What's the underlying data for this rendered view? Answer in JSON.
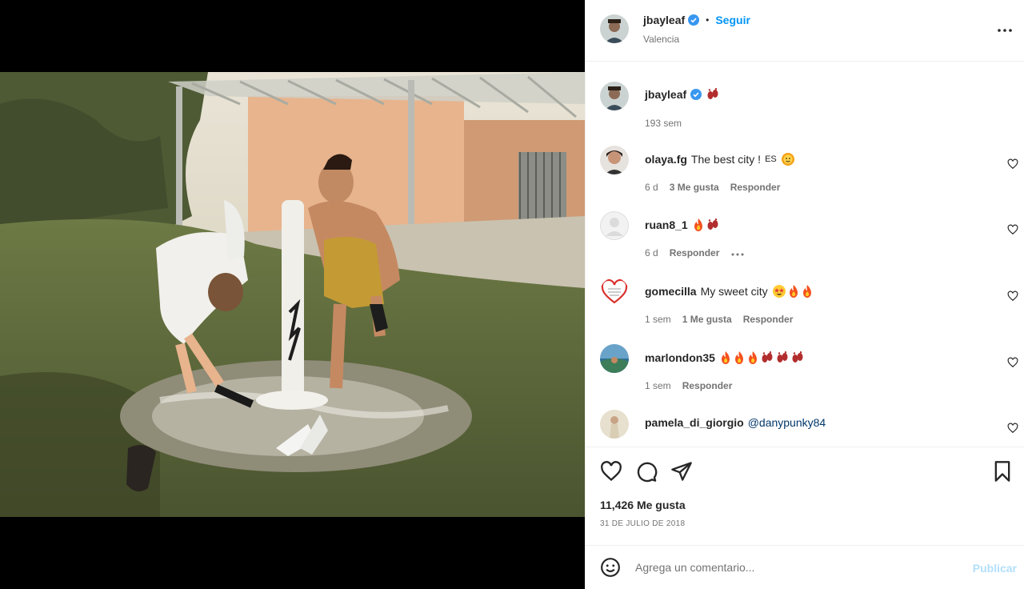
{
  "post": {
    "username": "jbayleaf",
    "follow_label": "Seguir",
    "location": "Valencia",
    "more_icon": "more-options-icon"
  },
  "caption": {
    "username": "jbayleaf",
    "emoji": "footprints",
    "time": "193 sem"
  },
  "comments": [
    {
      "username": "olaya.fg",
      "text": "The best city ! ",
      "flag": "ES",
      "emoji": [
        "sun-face"
      ],
      "time": "6 d",
      "likes": "3 Me gusta",
      "reply": "Responder"
    },
    {
      "username": "ruan8_1",
      "text": "",
      "emoji": [
        "fire",
        "footprints"
      ],
      "time": "6 d",
      "likes": "",
      "reply": "Responder",
      "has_more": true
    },
    {
      "username": "gomecilla",
      "text": "My sweet city",
      "emoji": [
        "star-struck",
        "fire",
        "fire"
      ],
      "time": "1 sem",
      "likes": "1 Me gusta",
      "reply": "Responder"
    },
    {
      "username": "marlondon35",
      "text": "",
      "emoji": [
        "fire",
        "fire",
        "fire",
        "footprints",
        "footprints",
        "footprints"
      ],
      "time": "1 sem",
      "likes": "",
      "reply": "Responder"
    },
    {
      "username": "pamela_di_giorgio",
      "mention": "@danypunky84",
      "emoji": []
    }
  ],
  "actions": {
    "likes": "11,426 Me gusta",
    "date": "31 de julio de 2018"
  },
  "add_comment": {
    "placeholder": "Agrega un comentario...",
    "publish_label": "Publicar"
  },
  "colors": {
    "accent": "#0095f6",
    "verified": "#3897f0",
    "publish_disabled": "#b2dffc"
  }
}
